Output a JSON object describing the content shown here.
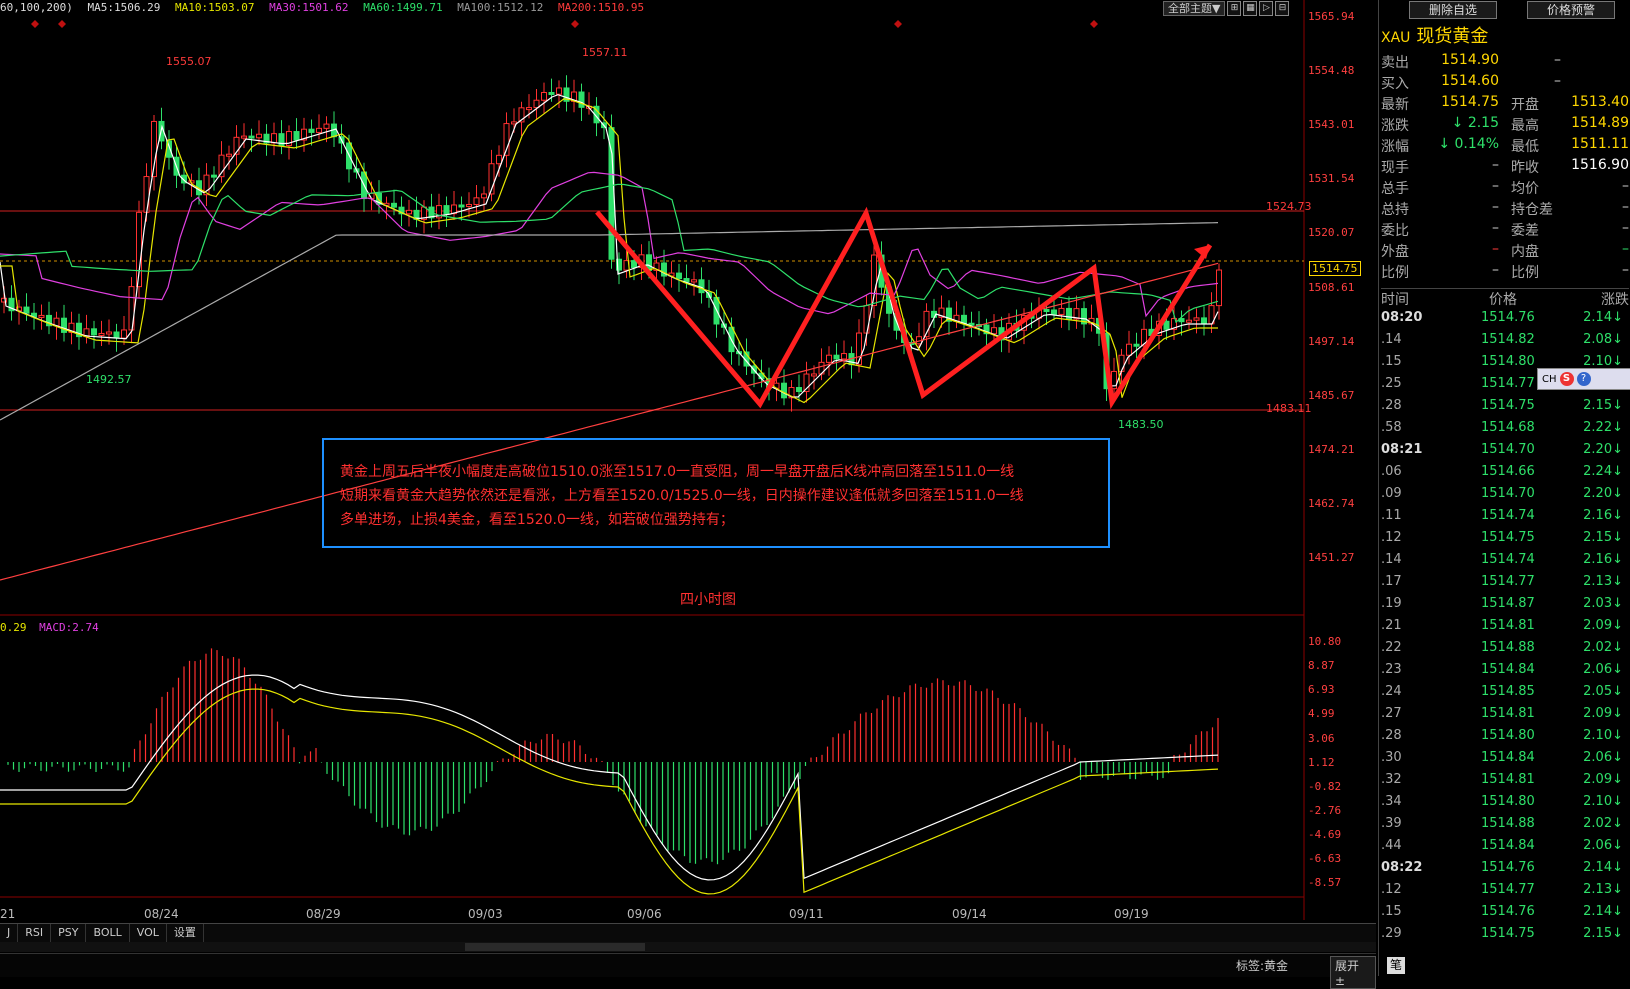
{
  "ma_bar": {
    "prefix": "60,100,200)",
    "ma5": "MA5:1506.29",
    "ma10": "MA10:1503.07",
    "ma30": "MA30:1501.62",
    "ma60": "MA60:1499.71",
    "ma100": "MA100:1512.12",
    "ma200": "MA200:1510.95"
  },
  "toolbar": {
    "theme_label": "全部主题▼",
    "icons": [
      "zoom-in-icon",
      "grid-icon",
      "play-icon",
      "expand-icon"
    ]
  },
  "price_axis": [
    "1565.94",
    "1554.48",
    "1543.01",
    "1531.54",
    "1520.07",
    "1508.61",
    "1497.14",
    "1485.67",
    "1474.21",
    "1462.74",
    "1451.27"
  ],
  "price_tags": {
    "high1": "1555.07",
    "high2": "1557.11",
    "low1": "1492.57",
    "low2": "1483.50",
    "resistance": "1524.73",
    "current": "1514.75",
    "support": "1483.11"
  },
  "macd_bar": {
    "prefix": "0.29",
    "macd": "MACD:2.74"
  },
  "macd_axis": [
    "10.80",
    "8.87",
    "6.93",
    "4.99",
    "3.06",
    "1.12",
    "-0.82",
    "-2.76",
    "-4.69",
    "-6.63",
    "-8.57"
  ],
  "x_axis": [
    "21",
    "08/24",
    "08/29",
    "09/03",
    "09/06",
    "09/11",
    "09/14",
    "09/19"
  ],
  "note": {
    "line1": "黄金上周五后半夜小幅度走高破位1510.0涨至1517.0一直受阻，周一早盘开盘后K线冲高回落至1511.0一线",
    "line2": "短期来看黄金大趋势依然还是看涨，上方看至1520.0/1525.0一线，日内操作建议逢低就多回落至1511.0一线",
    "line3": "多单进场，止损4美金，看至1520.0一线，如若破位强势持有；"
  },
  "chart_title": "四小时图",
  "bottom_tabs": [
    "J",
    "RSI",
    "PSY",
    "BOLL",
    "VOL",
    "设置"
  ],
  "status": {
    "label": "标签:黄金",
    "expand": "展开 ±",
    "pen": "笔"
  },
  "right_panel": {
    "delete_btn": "删除自选",
    "alert_btn": "价格预警",
    "code": "XAU",
    "name": "现货黄金",
    "quotes_left": [
      {
        "label": "卖出",
        "value": "1514.90",
        "color": "#ffd700",
        "extra": "–"
      },
      {
        "label": "买入",
        "value": "1514.60",
        "color": "#ffd700",
        "extra": "–"
      },
      {
        "label": "最新",
        "value": "1514.75",
        "color": "#ffd700"
      },
      {
        "label": "涨跌",
        "value": "↓ 2.15",
        "color": "#2ee06a"
      },
      {
        "label": "涨幅",
        "value": "↓ 0.14%",
        "color": "#2ee06a"
      },
      {
        "label": "现手",
        "value": "–",
        "color": "#ccc"
      },
      {
        "label": "总手",
        "value": "–",
        "color": "#ccc"
      },
      {
        "label": "总持",
        "value": "–",
        "color": "#ccc"
      },
      {
        "label": "委比",
        "value": "–",
        "color": "#ccc"
      },
      {
        "label": "外盘",
        "value": "–",
        "color": "#ff3b3b"
      },
      {
        "label": "比例",
        "value": "–",
        "color": "#ccc"
      }
    ],
    "quotes_right": [
      {
        "label": "开盘",
        "value": "1513.40",
        "color": "#ffd700"
      },
      {
        "label": "最高",
        "value": "1514.89",
        "color": "#ffd700"
      },
      {
        "label": "最低",
        "value": "1511.11",
        "color": "#ffd700"
      },
      {
        "label": "昨收",
        "value": "1516.90",
        "color": "#ffffff"
      },
      {
        "label": "均价",
        "value": "–",
        "color": "#ccc"
      },
      {
        "label": "持仓差",
        "value": "–",
        "color": "#ccc"
      },
      {
        "label": "委差",
        "value": "–",
        "color": "#ccc"
      },
      {
        "label": "内盘",
        "value": "–",
        "color": "#2ee06a"
      },
      {
        "label": "比例",
        "value": "–",
        "color": "#ccc"
      }
    ],
    "tick_header": {
      "time": "时间",
      "price": "价格",
      "change": "涨跌"
    },
    "ticks": [
      {
        "t": "08:20",
        "p": "1514.76",
        "c": "2.14↓",
        "big": true
      },
      {
        "t": ".14",
        "p": "1514.82",
        "c": "2.08↓"
      },
      {
        "t": ".15",
        "p": "1514.80",
        "c": "2.10↓"
      },
      {
        "t": ".25",
        "p": "1514.77",
        "c": "2.13↓"
      },
      {
        "t": ".28",
        "p": "1514.75",
        "c": "2.15↓"
      },
      {
        "t": ".58",
        "p": "1514.68",
        "c": "2.22↓"
      },
      {
        "t": "08:21",
        "p": "1514.70",
        "c": "2.20↓",
        "big": true
      },
      {
        "t": ".06",
        "p": "1514.66",
        "c": "2.24↓"
      },
      {
        "t": ".09",
        "p": "1514.70",
        "c": "2.20↓"
      },
      {
        "t": ".11",
        "p": "1514.74",
        "c": "2.16↓"
      },
      {
        "t": ".12",
        "p": "1514.75",
        "c": "2.15↓"
      },
      {
        "t": ".14",
        "p": "1514.74",
        "c": "2.16↓"
      },
      {
        "t": ".17",
        "p": "1514.77",
        "c": "2.13↓"
      },
      {
        "t": ".19",
        "p": "1514.87",
        "c": "2.03↓"
      },
      {
        "t": ".21",
        "p": "1514.81",
        "c": "2.09↓"
      },
      {
        "t": ".22",
        "p": "1514.88",
        "c": "2.02↓"
      },
      {
        "t": ".23",
        "p": "1514.84",
        "c": "2.06↓"
      },
      {
        "t": ".24",
        "p": "1514.85",
        "c": "2.05↓"
      },
      {
        "t": ".27",
        "p": "1514.81",
        "c": "2.09↓"
      },
      {
        "t": ".28",
        "p": "1514.80",
        "c": "2.10↓"
      },
      {
        "t": ".30",
        "p": "1514.84",
        "c": "2.06↓"
      },
      {
        "t": ".32",
        "p": "1514.81",
        "c": "2.09↓"
      },
      {
        "t": ".34",
        "p": "1514.80",
        "c": "2.10↓"
      },
      {
        "t": ".39",
        "p": "1514.88",
        "c": "2.02↓"
      },
      {
        "t": ".44",
        "p": "1514.84",
        "c": "2.06↓"
      },
      {
        "t": "08:22",
        "p": "1514.76",
        "c": "2.14↓",
        "big": true
      },
      {
        "t": ".12",
        "p": "1514.77",
        "c": "2.13↓"
      },
      {
        "t": ".15",
        "p": "1514.76",
        "c": "2.14↓"
      },
      {
        "t": ".29",
        "p": "1514.75",
        "c": "2.15↓"
      }
    ],
    "ime": {
      "lang": "CH",
      "s": "S",
      "help": "?"
    }
  }
}
